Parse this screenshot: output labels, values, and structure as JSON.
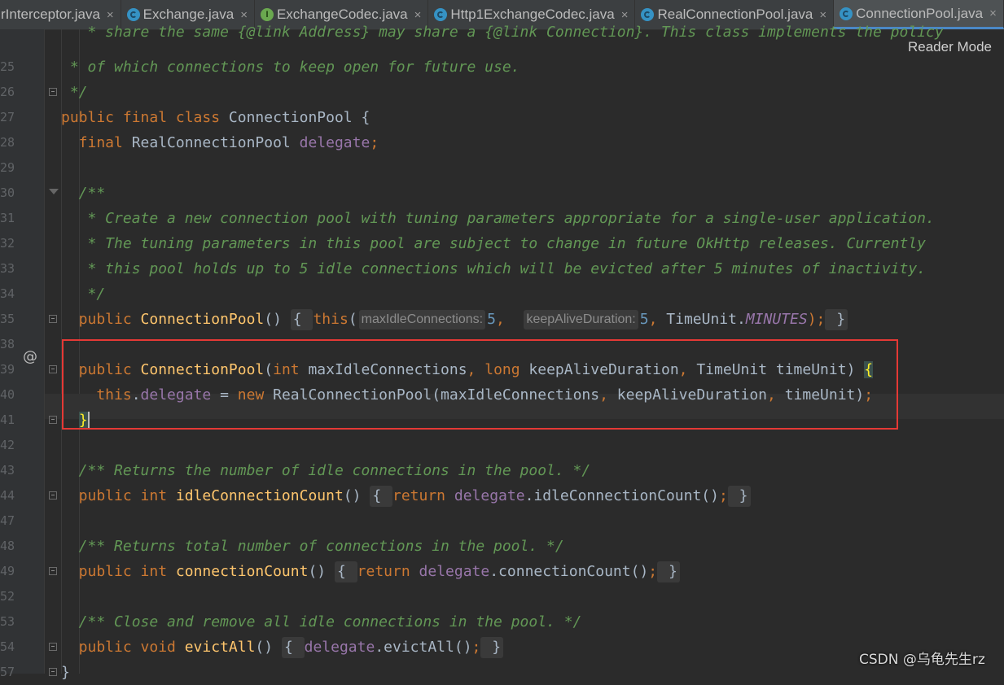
{
  "tabs": [
    {
      "label": "rInterceptor.java",
      "icon": "class-icon",
      "active": false
    },
    {
      "label": "Exchange.java",
      "icon": "class-icon",
      "active": false
    },
    {
      "label": "ExchangeCodec.java",
      "icon": "interface-icon",
      "active": false
    },
    {
      "label": "Http1ExchangeCodec.java",
      "icon": "class-icon",
      "active": false
    },
    {
      "label": "RealConnectionPool.java",
      "icon": "class-icon",
      "active": false
    },
    {
      "label": "ConnectionPool.java",
      "icon": "class-icon",
      "active": true
    }
  ],
  "reader_mode": "Reader Mode",
  "line_numbers": [
    "",
    "25",
    "26",
    "27",
    "28",
    "29",
    "30",
    "31",
    "32",
    "33",
    "34",
    "35",
    "38",
    "39",
    "40",
    "41",
    "42",
    "43",
    "44",
    "47",
    "48",
    "49",
    "52",
    "53",
    "54",
    "57"
  ],
  "code_lines": [
    [
      {
        "t": "   * share the same {@link Address} may share a {@link Connection}. This class implements the policy",
        "k": "com"
      }
    ],
    [
      {
        "t": " * of which connections to keep open for future use.",
        "k": "com"
      }
    ],
    [
      {
        "t": " */",
        "k": "com"
      }
    ],
    [
      {
        "t": "public final class ",
        "k": "kw"
      },
      {
        "t": "ConnectionPool {",
        "k": "txt"
      }
    ],
    [
      {
        "t": "  final ",
        "k": "kw"
      },
      {
        "t": "RealConnectionPool ",
        "k": "txt"
      },
      {
        "t": "delegate",
        "k": "fld"
      },
      {
        "t": ";",
        "k": "kw"
      }
    ],
    [],
    [
      {
        "t": "  /**",
        "k": "com"
      }
    ],
    [
      {
        "t": "   * Create a new connection pool with tuning parameters appropriate for a single-user application.",
        "k": "com"
      }
    ],
    [
      {
        "t": "   * The tuning parameters in this pool are subject to change in future OkHttp releases. Currently",
        "k": "com"
      }
    ],
    [
      {
        "t": "   * this pool holds up to 5 idle connections which will be evicted after 5 minutes of inactivity.",
        "k": "com"
      }
    ],
    [
      {
        "t": "   */",
        "k": "com"
      }
    ],
    [
      {
        "t": "  public ",
        "k": "kw"
      },
      {
        "t": "ConnectionPool",
        "k": "fn"
      },
      {
        "t": "() ",
        "k": "txt"
      },
      {
        "t": "{ ",
        "k": "fb"
      },
      {
        "t": "this",
        "k": "kw"
      },
      {
        "t": "(",
        "k": "txt"
      },
      {
        "t": "maxIdleConnections:",
        "k": "hint"
      },
      {
        "t": "5",
        "k": "num"
      },
      {
        "t": ",  ",
        "k": "kw"
      },
      {
        "t": "keepAliveDuration:",
        "k": "hint"
      },
      {
        "t": "5",
        "k": "num"
      },
      {
        "t": ", ",
        "k": "kw"
      },
      {
        "t": "TimeUnit.",
        "k": "txt"
      },
      {
        "t": "MINUTES",
        "k": "stc"
      },
      {
        "t": ");",
        "k": "kw"
      },
      {
        "t": " }",
        "k": "fb"
      }
    ],
    [],
    [
      {
        "t": "  public ",
        "k": "kw"
      },
      {
        "t": "ConnectionPool",
        "k": "fn"
      },
      {
        "t": "(",
        "k": "txt"
      },
      {
        "t": "int ",
        "k": "kw"
      },
      {
        "t": "maxIdleConnections",
        "k": "txt"
      },
      {
        "t": ", ",
        "k": "kw"
      },
      {
        "t": "long ",
        "k": "kw"
      },
      {
        "t": "keepAliveDuration",
        "k": "txt"
      },
      {
        "t": ", ",
        "k": "kw"
      },
      {
        "t": "TimeUnit timeUnit) ",
        "k": "txt"
      },
      {
        "t": "{",
        "k": "bhl"
      }
    ],
    [
      {
        "t": "    this",
        "k": "kw"
      },
      {
        "t": ".",
        "k": "txt"
      },
      {
        "t": "delegate",
        "k": "fld"
      },
      {
        "t": " = ",
        "k": "txt"
      },
      {
        "t": "new ",
        "k": "kw"
      },
      {
        "t": "RealConnectionPool(maxIdleConnections",
        "k": "txt"
      },
      {
        "t": ", ",
        "k": "kw"
      },
      {
        "t": "keepAliveDuration",
        "k": "txt"
      },
      {
        "t": ", ",
        "k": "kw"
      },
      {
        "t": "timeUnit)",
        "k": "txt"
      },
      {
        "t": ";",
        "k": "kw"
      }
    ],
    [
      {
        "t": "  ",
        "k": "txt"
      },
      {
        "t": "}",
        "k": "bhl"
      },
      {
        "t": "",
        "k": "caret"
      }
    ],
    [],
    [
      {
        "t": "  /** Returns the number of idle connections in the pool. */",
        "k": "com"
      }
    ],
    [
      {
        "t": "  public int ",
        "k": "kw"
      },
      {
        "t": "idleConnectionCount",
        "k": "fn"
      },
      {
        "t": "() ",
        "k": "txt"
      },
      {
        "t": "{ ",
        "k": "fb"
      },
      {
        "t": "return ",
        "k": "kw"
      },
      {
        "t": "delegate",
        "k": "fld"
      },
      {
        "t": ".idleConnectionCount()",
        "k": "txt"
      },
      {
        "t": ";",
        "k": "kw"
      },
      {
        "t": " }",
        "k": "fb"
      }
    ],
    [],
    [
      {
        "t": "  /** Returns total number of connections in the pool. */",
        "k": "com"
      }
    ],
    [
      {
        "t": "  public int ",
        "k": "kw"
      },
      {
        "t": "connectionCount",
        "k": "fn"
      },
      {
        "t": "() ",
        "k": "txt"
      },
      {
        "t": "{ ",
        "k": "fb"
      },
      {
        "t": "return ",
        "k": "kw"
      },
      {
        "t": "delegate",
        "k": "fld"
      },
      {
        "t": ".connectionCount()",
        "k": "txt"
      },
      {
        "t": ";",
        "k": "kw"
      },
      {
        "t": " }",
        "k": "fb"
      }
    ],
    [],
    [
      {
        "t": "  /** Close and remove all idle connections in the pool. */",
        "k": "com"
      }
    ],
    [
      {
        "t": "  public void ",
        "k": "kw"
      },
      {
        "t": "evictAll",
        "k": "fn"
      },
      {
        "t": "() ",
        "k": "txt"
      },
      {
        "t": "{ ",
        "k": "fb"
      },
      {
        "t": "delegate",
        "k": "fld"
      },
      {
        "t": ".evictAll()",
        "k": "txt"
      },
      {
        "t": ";",
        "k": "kw"
      },
      {
        "t": " }",
        "k": "fb"
      }
    ],
    [
      {
        "t": "}",
        "k": "txt"
      }
    ]
  ],
  "watermark": "CSDN @乌龟先生rz",
  "colors": {
    "background": "#2b2b2b",
    "keyword": "#cc7832",
    "comment": "#629755",
    "method": "#ffc66d",
    "field": "#9876aa",
    "number": "#6897bb",
    "highlight_box": "#e53935"
  }
}
